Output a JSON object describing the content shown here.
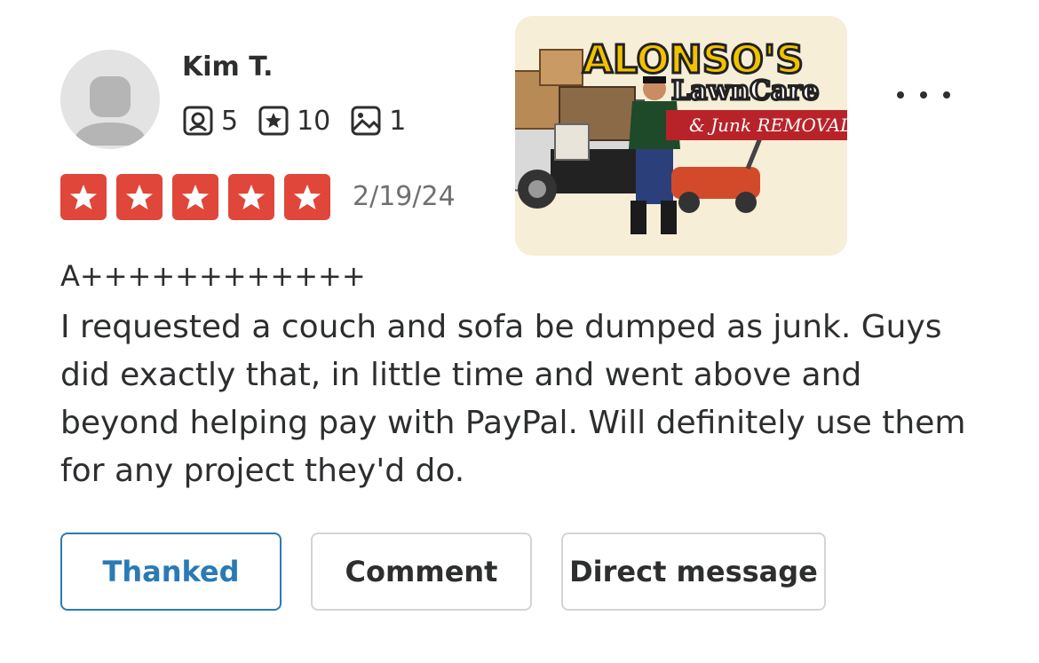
{
  "reviewer": {
    "name": "Kim T.",
    "reviews_count": "5",
    "friends_count": "10",
    "photos_count": "1"
  },
  "rating": {
    "stars": 5,
    "date": "2/19/24",
    "star_color": "#e0463a"
  },
  "business_photo": {
    "title_line1": "ALONSO'S",
    "title_line2": "LawnCare",
    "title_line3": "& Junk REMOVAL"
  },
  "review": {
    "title": "A++++++++++++",
    "body": "I requested a couch and sofa be dumped as junk. Guys did exactly that, in little time and went above and beyond helping pay with PayPal. Will definitely use them for any project they'd do."
  },
  "actions": {
    "thanked_label": "Thanked",
    "comment_label": "Comment",
    "dm_label": "Direct message",
    "active_color": "#2a7bb5"
  },
  "icons": {
    "more": "more-horizontal-icon",
    "reviews": "review-icon",
    "friends": "star-badge-icon",
    "photos": "photo-icon"
  }
}
